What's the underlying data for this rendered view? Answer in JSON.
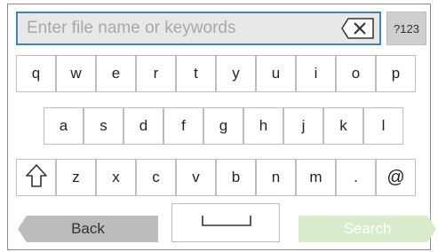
{
  "search": {
    "placeholder": "Enter file name or keywords",
    "value": ""
  },
  "mode_label": "?123",
  "keys": {
    "row1": [
      "q",
      "w",
      "e",
      "r",
      "t",
      "y",
      "u",
      "i",
      "o",
      "p"
    ],
    "row2": [
      "a",
      "s",
      "d",
      "f",
      "g",
      "h",
      "j",
      "k",
      "l"
    ],
    "row3": [
      "z",
      "x",
      "c",
      "v",
      "b",
      "n",
      "m",
      ".",
      "@"
    ]
  },
  "back_label": "Back",
  "search_label": "Search",
  "icons": {
    "backspace": "backspace-icon",
    "shift": "shift-icon",
    "space": "space-bar-icon"
  },
  "colors": {
    "input_border": "#3a87c4",
    "back_button": "#bcbcbc",
    "search_button": "#d8eccb"
  }
}
